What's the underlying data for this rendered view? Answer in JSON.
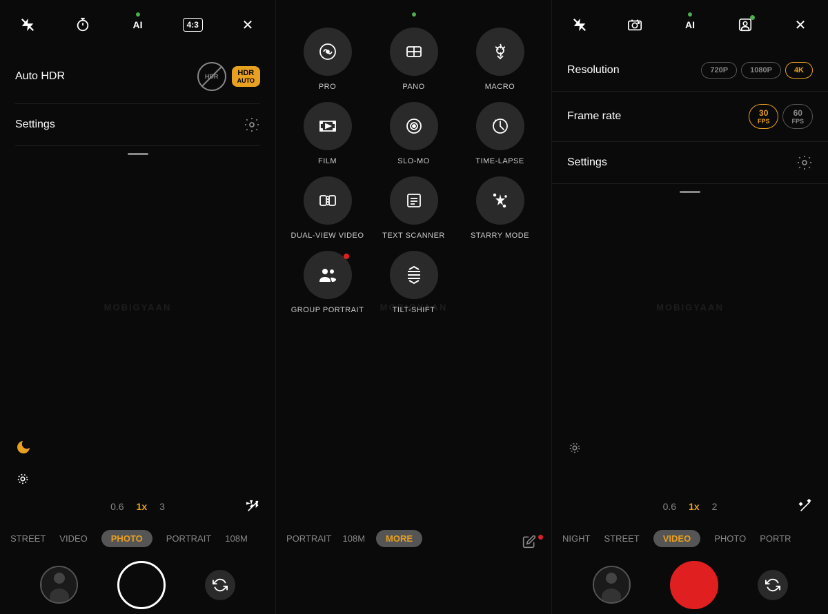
{
  "panels": {
    "left": {
      "top_icons": [
        {
          "name": "flash-off-icon",
          "symbol": "⚡",
          "type": "flash-off"
        },
        {
          "name": "timer-icon",
          "symbol": "⏱",
          "type": "timer"
        },
        {
          "name": "ai-icon",
          "symbol": "AI",
          "type": "ai"
        },
        {
          "name": "ratio-icon",
          "symbol": "4:3",
          "type": "ratio"
        },
        {
          "name": "close-icon",
          "symbol": "✕",
          "type": "close"
        }
      ],
      "settings": {
        "auto_hdr_label": "Auto HDR",
        "settings_label": "Settings"
      },
      "zoom_values": [
        "0.6",
        "1x",
        "3"
      ],
      "modes": [
        "STREET",
        "VIDEO",
        "PHOTO",
        "PORTRAIT",
        "108M"
      ],
      "active_mode": "PHOTO",
      "watermark": "MOBIGYAAN"
    },
    "middle": {
      "green_dot": true,
      "mode_grid": [
        {
          "id": "pro",
          "label": "PRO",
          "icon": "⚙"
        },
        {
          "id": "pano",
          "label": "PANO",
          "icon": "⊡"
        },
        {
          "id": "macro",
          "label": "MACRO",
          "icon": "✿"
        },
        {
          "id": "film",
          "label": "FILM",
          "icon": "🎬"
        },
        {
          "id": "slo-mo",
          "label": "SLO-MO",
          "icon": "◎"
        },
        {
          "id": "time-lapse",
          "label": "TIME-LAPSE",
          "icon": "⊙"
        },
        {
          "id": "dual-view",
          "label": "DUAL-VIEW VIDEO",
          "icon": "⊞"
        },
        {
          "id": "text-scanner",
          "label": "TEXT SCANNER",
          "icon": "⊡"
        },
        {
          "id": "starry-mode",
          "label": "STARRY MODE",
          "icon": "✦"
        },
        {
          "id": "group-portrait",
          "label": "GROUP PORTRAIT",
          "icon": "👥",
          "has_dot": true
        },
        {
          "id": "tilt-shift",
          "label": "TILT-SHIFT",
          "icon": "≋"
        }
      ],
      "bottom_modes": [
        "PORTRAIT",
        "108M",
        "MORE"
      ],
      "active_bottom_mode": "MORE",
      "watermark": "MOBIGYAAN"
    },
    "right": {
      "top_icons": [
        {
          "name": "flash-off-icon",
          "symbol": "⚡",
          "type": "flash-off"
        },
        {
          "name": "front-camera-icon",
          "symbol": "📷",
          "type": "camera-switch"
        },
        {
          "name": "ai-icon",
          "symbol": "AI",
          "type": "ai"
        },
        {
          "name": "face-icon",
          "symbol": "⊡",
          "type": "face",
          "has_dot": true
        },
        {
          "name": "close-icon",
          "symbol": "✕",
          "type": "close"
        }
      ],
      "resolution": {
        "label": "Resolution",
        "options": [
          "720P",
          "1080P",
          "4K"
        ],
        "active": "4K"
      },
      "frame_rate": {
        "label": "Frame rate",
        "options": [
          {
            "label": "30",
            "sub": "FPS"
          },
          {
            "label": "60",
            "sub": "FPS"
          }
        ],
        "active": "30"
      },
      "settings_label": "Settings",
      "zoom_values": [
        "0.6",
        "1x",
        "2"
      ],
      "modes": [
        "NIGHT",
        "STREET",
        "VIDEO",
        "PHOTO",
        "PORTR"
      ],
      "active_mode": "VIDEO",
      "watermark": "MOBIGYAAN"
    }
  }
}
